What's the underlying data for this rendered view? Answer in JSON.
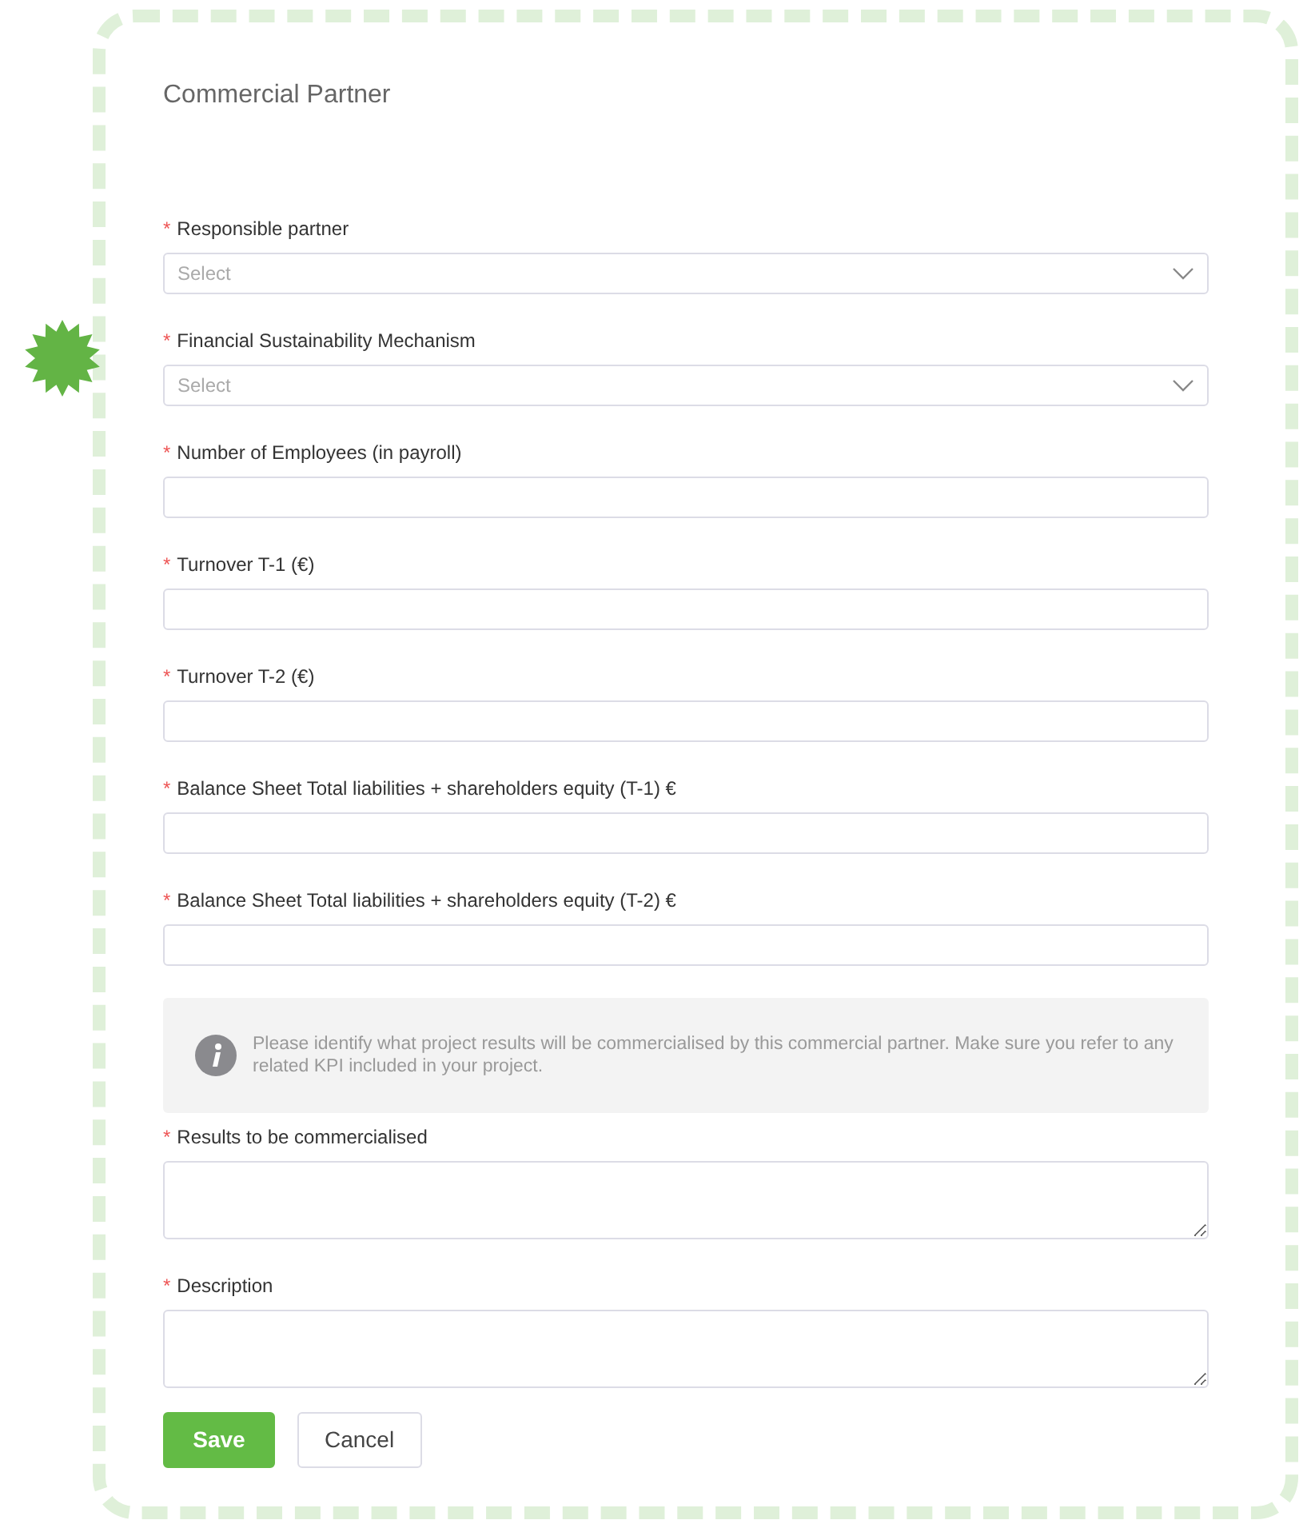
{
  "title": "Commercial Partner",
  "fields": [
    {
      "kind": "select",
      "mark": "*",
      "label": "Responsible partner",
      "placeholder": "Select"
    },
    {
      "kind": "select",
      "mark": "*",
      "label": "Financial Sustainability Mechanism",
      "placeholder": "Select"
    },
    {
      "kind": "text",
      "mark": "*",
      "label": "Number of Employees (in payroll)"
    },
    {
      "kind": "text",
      "mark": "*",
      "label": "Turnover T-1 (€)"
    },
    {
      "kind": "text",
      "mark": "*",
      "label": "Turnover T-2 (€)"
    },
    {
      "kind": "text",
      "mark": "*",
      "label": "Balance Sheet Total liabilities + shareholders equity (T-1) €"
    },
    {
      "kind": "text",
      "mark": "*",
      "label": "Balance Sheet Total liabilities + shareholders equity (T-2) €"
    },
    {
      "kind": "note",
      "text": "Please identify what project results will be commercialised by this commercial partner. Make sure you refer to any related KPI included in your project."
    },
    {
      "kind": "textarea",
      "mark": "*",
      "label": "Results to be commercialised"
    },
    {
      "kind": "textarea",
      "mark": "*",
      "label": "Description"
    }
  ],
  "buttons": [
    {
      "kind": "primary",
      "label": "Save"
    },
    {
      "kind": "secondary",
      "label": "Cancel"
    }
  ]
}
